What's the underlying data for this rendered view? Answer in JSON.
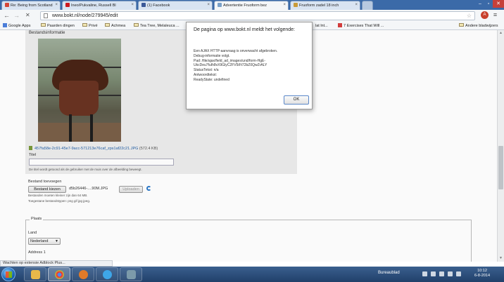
{
  "tabs": [
    {
      "label": "Re: Being from Scotland",
      "icon": "gmail-icon",
      "color": "#d44638"
    },
    {
      "label": "Ineo/Pukvaline, Russell Bl",
      "icon": "youtube-icon",
      "color": "#cc181e"
    },
    {
      "label": "(1) Facebook",
      "icon": "facebook-icon",
      "color": "#3b5998"
    },
    {
      "label": "Advertentie Fruoform bez",
      "icon": "bokt-icon",
      "color": "#7aa0c8"
    },
    {
      "label": "Fruoform zadel 18 inch",
      "icon": "page-icon",
      "color": "#c99b3a"
    }
  ],
  "toolbar": {
    "back": "←",
    "forward": "→",
    "stop": "✕",
    "url": "www.bokt.nl/node/279945/edit",
    "star": "☆",
    "ext1": "A",
    "ext2": "≡"
  },
  "bookmarks": [
    {
      "label": "Google Apps",
      "type": "google"
    },
    {
      "label": "Paarden dingen",
      "type": "folder"
    },
    {
      "label": "Privé",
      "type": "folder"
    },
    {
      "label": "Achmea",
      "type": "folder"
    },
    {
      "label": "Tea Tree, Melaleuca ...",
      "type": "folder"
    },
    {
      "label": "lat lnt...",
      "type": "folder"
    },
    {
      "label": "7 Exercises That Will ...",
      "type": "page"
    },
    {
      "label": "Andere bladwijzers",
      "type": "folder"
    }
  ],
  "page": {
    "section_title": "Bestandsinformatie",
    "file_name": "457fa58e-2c91-45e7-9acc-571213e76caf_zps1af22c21.JPG",
    "file_size": "(572.4 KB)",
    "title_label": "Titel",
    "title_value": "",
    "title_hint": "De titel wordt getoond als de gebruiker met de muis over de afbeelding beweegt.",
    "upload_section": "Bestand toevoegen",
    "choose_button": "Bestand kiezen",
    "chosen_file": "d5b26446-....90M.JPG",
    "upload_button": "Uploaden",
    "hint_size": "Bestanden moeten kleiner zijn dan 64 MB.",
    "hint_types": "Toegestane bestandstypen: png gif jpg jpeg.",
    "place_legend": "Plaats",
    "country_label": "Land",
    "country_value": "Nederland",
    "address_label": "Address 1"
  },
  "dialog": {
    "title": "De pagina op www.bokt.nl meldt het volgende:",
    "lines": [
      "Een AJAX HTTP-aanvraag is onverwacht afgebroken.",
      "Debug-informatie volgt.",
      "Pad: /file/ajax/field_ad_images/und/form-HgE-",
      "UkcDeu7fuIh8vX9GlyC2FV5iFt72bZ0QwZrALY",
      "StatusTekst: n/a",
      "Antwoordtekst:",
      "ReadyState: undefined"
    ],
    "ok": "OK"
  },
  "status_bar": "Wachten op extensie Adblock Plus...",
  "taskbar": {
    "desktop_label": "Bureaublad",
    "time": "10:12",
    "date": "6-8-2014",
    "apps": [
      {
        "name": "explorer",
        "color": "#e8b84a"
      },
      {
        "name": "chrome",
        "color": "#4aa04a"
      },
      {
        "name": "media",
        "color": "#e07a28"
      },
      {
        "name": "skype",
        "color": "#3ea6e8"
      },
      {
        "name": "tool",
        "color": "#7c9aaa"
      }
    ]
  }
}
